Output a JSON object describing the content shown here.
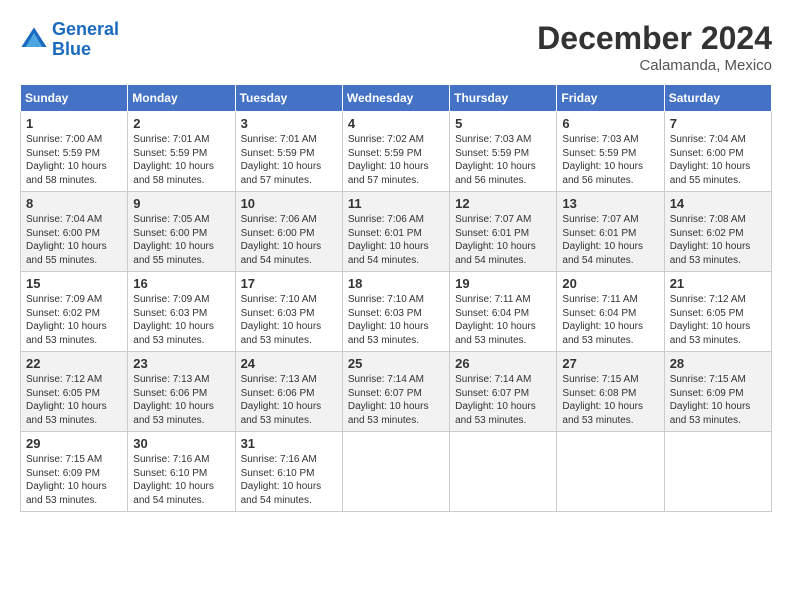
{
  "logo": {
    "line1": "General",
    "line2": "Blue"
  },
  "title": "December 2024",
  "subtitle": "Calamanda, Mexico",
  "weekdays": [
    "Sunday",
    "Monday",
    "Tuesday",
    "Wednesday",
    "Thursday",
    "Friday",
    "Saturday"
  ],
  "weeks": [
    [
      {
        "day": "1",
        "sunrise": "Sunrise: 7:00 AM",
        "sunset": "Sunset: 5:59 PM",
        "daylight": "Daylight: 10 hours and 58 minutes."
      },
      {
        "day": "2",
        "sunrise": "Sunrise: 7:01 AM",
        "sunset": "Sunset: 5:59 PM",
        "daylight": "Daylight: 10 hours and 58 minutes."
      },
      {
        "day": "3",
        "sunrise": "Sunrise: 7:01 AM",
        "sunset": "Sunset: 5:59 PM",
        "daylight": "Daylight: 10 hours and 57 minutes."
      },
      {
        "day": "4",
        "sunrise": "Sunrise: 7:02 AM",
        "sunset": "Sunset: 5:59 PM",
        "daylight": "Daylight: 10 hours and 57 minutes."
      },
      {
        "day": "5",
        "sunrise": "Sunrise: 7:03 AM",
        "sunset": "Sunset: 5:59 PM",
        "daylight": "Daylight: 10 hours and 56 minutes."
      },
      {
        "day": "6",
        "sunrise": "Sunrise: 7:03 AM",
        "sunset": "Sunset: 5:59 PM",
        "daylight": "Daylight: 10 hours and 56 minutes."
      },
      {
        "day": "7",
        "sunrise": "Sunrise: 7:04 AM",
        "sunset": "Sunset: 6:00 PM",
        "daylight": "Daylight: 10 hours and 55 minutes."
      }
    ],
    [
      {
        "day": "8",
        "sunrise": "Sunrise: 7:04 AM",
        "sunset": "Sunset: 6:00 PM",
        "daylight": "Daylight: 10 hours and 55 minutes."
      },
      {
        "day": "9",
        "sunrise": "Sunrise: 7:05 AM",
        "sunset": "Sunset: 6:00 PM",
        "daylight": "Daylight: 10 hours and 55 minutes."
      },
      {
        "day": "10",
        "sunrise": "Sunrise: 7:06 AM",
        "sunset": "Sunset: 6:00 PM",
        "daylight": "Daylight: 10 hours and 54 minutes."
      },
      {
        "day": "11",
        "sunrise": "Sunrise: 7:06 AM",
        "sunset": "Sunset: 6:01 PM",
        "daylight": "Daylight: 10 hours and 54 minutes."
      },
      {
        "day": "12",
        "sunrise": "Sunrise: 7:07 AM",
        "sunset": "Sunset: 6:01 PM",
        "daylight": "Daylight: 10 hours and 54 minutes."
      },
      {
        "day": "13",
        "sunrise": "Sunrise: 7:07 AM",
        "sunset": "Sunset: 6:01 PM",
        "daylight": "Daylight: 10 hours and 54 minutes."
      },
      {
        "day": "14",
        "sunrise": "Sunrise: 7:08 AM",
        "sunset": "Sunset: 6:02 PM",
        "daylight": "Daylight: 10 hours and 53 minutes."
      }
    ],
    [
      {
        "day": "15",
        "sunrise": "Sunrise: 7:09 AM",
        "sunset": "Sunset: 6:02 PM",
        "daylight": "Daylight: 10 hours and 53 minutes."
      },
      {
        "day": "16",
        "sunrise": "Sunrise: 7:09 AM",
        "sunset": "Sunset: 6:03 PM",
        "daylight": "Daylight: 10 hours and 53 minutes."
      },
      {
        "day": "17",
        "sunrise": "Sunrise: 7:10 AM",
        "sunset": "Sunset: 6:03 PM",
        "daylight": "Daylight: 10 hours and 53 minutes."
      },
      {
        "day": "18",
        "sunrise": "Sunrise: 7:10 AM",
        "sunset": "Sunset: 6:03 PM",
        "daylight": "Daylight: 10 hours and 53 minutes."
      },
      {
        "day": "19",
        "sunrise": "Sunrise: 7:11 AM",
        "sunset": "Sunset: 6:04 PM",
        "daylight": "Daylight: 10 hours and 53 minutes."
      },
      {
        "day": "20",
        "sunrise": "Sunrise: 7:11 AM",
        "sunset": "Sunset: 6:04 PM",
        "daylight": "Daylight: 10 hours and 53 minutes."
      },
      {
        "day": "21",
        "sunrise": "Sunrise: 7:12 AM",
        "sunset": "Sunset: 6:05 PM",
        "daylight": "Daylight: 10 hours and 53 minutes."
      }
    ],
    [
      {
        "day": "22",
        "sunrise": "Sunrise: 7:12 AM",
        "sunset": "Sunset: 6:05 PM",
        "daylight": "Daylight: 10 hours and 53 minutes."
      },
      {
        "day": "23",
        "sunrise": "Sunrise: 7:13 AM",
        "sunset": "Sunset: 6:06 PM",
        "daylight": "Daylight: 10 hours and 53 minutes."
      },
      {
        "day": "24",
        "sunrise": "Sunrise: 7:13 AM",
        "sunset": "Sunset: 6:06 PM",
        "daylight": "Daylight: 10 hours and 53 minutes."
      },
      {
        "day": "25",
        "sunrise": "Sunrise: 7:14 AM",
        "sunset": "Sunset: 6:07 PM",
        "daylight": "Daylight: 10 hours and 53 minutes."
      },
      {
        "day": "26",
        "sunrise": "Sunrise: 7:14 AM",
        "sunset": "Sunset: 6:07 PM",
        "daylight": "Daylight: 10 hours and 53 minutes."
      },
      {
        "day": "27",
        "sunrise": "Sunrise: 7:15 AM",
        "sunset": "Sunset: 6:08 PM",
        "daylight": "Daylight: 10 hours and 53 minutes."
      },
      {
        "day": "28",
        "sunrise": "Sunrise: 7:15 AM",
        "sunset": "Sunset: 6:09 PM",
        "daylight": "Daylight: 10 hours and 53 minutes."
      }
    ],
    [
      {
        "day": "29",
        "sunrise": "Sunrise: 7:15 AM",
        "sunset": "Sunset: 6:09 PM",
        "daylight": "Daylight: 10 hours and 53 minutes."
      },
      {
        "day": "30",
        "sunrise": "Sunrise: 7:16 AM",
        "sunset": "Sunset: 6:10 PM",
        "daylight": "Daylight: 10 hours and 54 minutes."
      },
      {
        "day": "31",
        "sunrise": "Sunrise: 7:16 AM",
        "sunset": "Sunset: 6:10 PM",
        "daylight": "Daylight: 10 hours and 54 minutes."
      },
      null,
      null,
      null,
      null
    ]
  ]
}
